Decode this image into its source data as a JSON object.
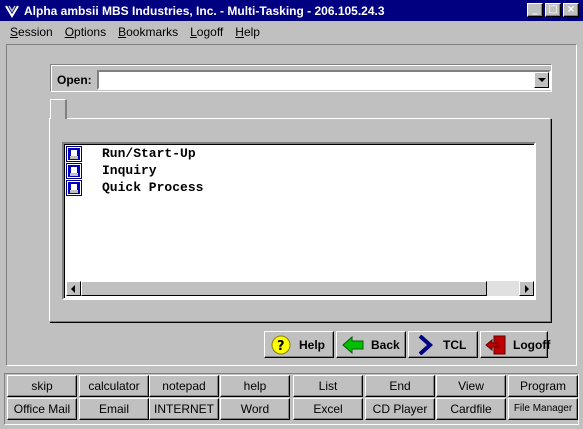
{
  "window": {
    "title": "Alpha ambsii MBS Industries, Inc. - Multi-Tasking - 206.105.24.3",
    "minimize": "_",
    "maximize": "□",
    "close": "×"
  },
  "menu": [
    {
      "u": "S",
      "rest": "ession"
    },
    {
      "u": "O",
      "rest": "ptions"
    },
    {
      "u": "B",
      "rest": "ookmarks"
    },
    {
      "u": "L",
      "rest": "ogoff"
    },
    {
      "u": "H",
      "rest": "elp"
    }
  ],
  "open": {
    "label": "Open:",
    "value": ""
  },
  "list": {
    "items": [
      {
        "label": "Run/Start-Up"
      },
      {
        "label": "Inquiry"
      },
      {
        "label": "Quick Process"
      }
    ]
  },
  "nav": {
    "help": "Help",
    "back": "Back",
    "tcl": "TCL",
    "logoff": "Logoff",
    "colors": {
      "help_icon": "#ffff00",
      "back_icon": "#00c000",
      "tcl_icon": "#000080",
      "logoff_icon": "#c00000"
    }
  },
  "quick": {
    "row1": [
      "skip",
      "calculator",
      "notepad",
      "help",
      "List",
      "End",
      "View",
      "Program"
    ],
    "row2": [
      "Office Mail",
      "Email",
      "INTERNET",
      "Word",
      "Excel",
      "CD Player",
      "Cardfile",
      "File Manager"
    ]
  }
}
